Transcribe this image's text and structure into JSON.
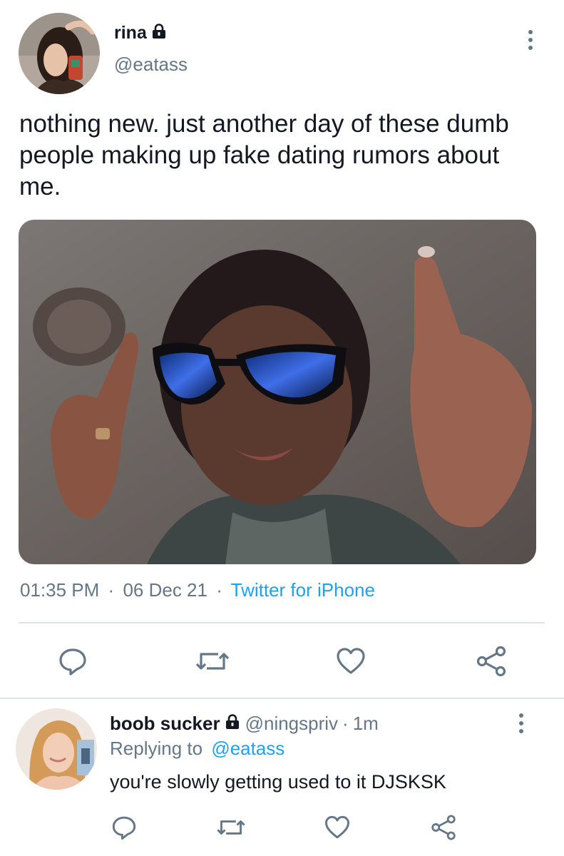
{
  "tweet": {
    "display_name": "rina",
    "handle": "@eatass",
    "text": "nothing new. just another day of these dumb people making up fake dating rumors about me.",
    "time": "01:35 PM",
    "separator": "·",
    "date": "06 Dec 21",
    "source": "Twitter for iPhone"
  },
  "reply": {
    "display_name": "boob sucker",
    "handle": "@ningspriv",
    "separator": "·",
    "age": "1m",
    "replying_prefix": "Replying to",
    "replying_handle": "@eatass",
    "text": "you're slowly getting used to it DJSKSK"
  },
  "icons": {
    "lock": "lock-icon",
    "more": "more-vertical-icon",
    "reply": "reply-icon",
    "retweet": "retweet-icon",
    "like": "heart-icon",
    "share": "share-icon"
  },
  "colors": {
    "text": "#141823",
    "muted": "#657786",
    "link": "#1da1f2",
    "divider": "#dfe3e8"
  }
}
